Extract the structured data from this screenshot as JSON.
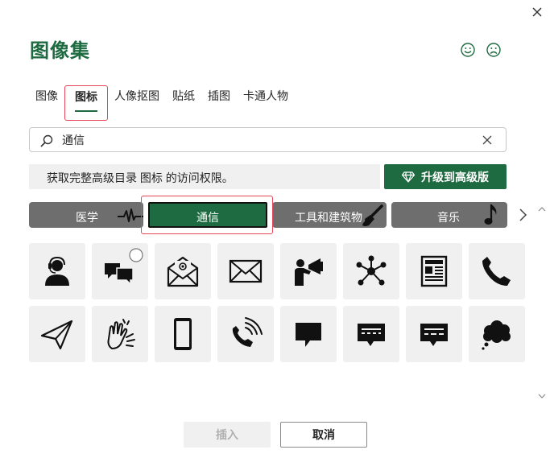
{
  "dialog": {
    "title": "图像集",
    "close_icon": "close-icon",
    "feedback": {
      "happy_icon": "smiley-icon",
      "sad_icon": "frown-icon"
    }
  },
  "tabs": [
    {
      "label": "图像",
      "active": false
    },
    {
      "label": "图标",
      "active": true
    },
    {
      "label": "人像抠图",
      "active": false
    },
    {
      "label": "贴纸",
      "active": false
    },
    {
      "label": "插图",
      "active": false
    },
    {
      "label": "卡通人物",
      "active": false
    }
  ],
  "search": {
    "value": "通信",
    "search_icon": "search-icon",
    "clear_icon": "clear-icon"
  },
  "notice": {
    "text": "获取完整高级目录 图标 的访问权限。"
  },
  "upgrade": {
    "label": "升级到高级版",
    "icon": "diamond-icon"
  },
  "categories": [
    {
      "label": "医学",
      "icon": "heartbeat-icon"
    },
    {
      "label": "通信",
      "selected": true
    },
    {
      "label": "工具和建筑物",
      "icon": "paintbrush-icon"
    },
    {
      "label": "音乐",
      "icon": "music-note-icon"
    }
  ],
  "icons": [
    "headset-agent-icon",
    "chat-bubbles-icon",
    "email-envelope-icon",
    "envelope-icon",
    "megaphone-person-icon",
    "network-hub-icon",
    "newspaper-icon",
    "phone-handset-icon",
    "paper-plane-icon",
    "sign-language-icon",
    "smartphone-icon",
    "phone-ringing-icon",
    "speech-bubble-icon",
    "message-bubble-icon",
    "message-bubble-text-icon",
    "thought-cloud-icon"
  ],
  "buttons": {
    "insert": "插入",
    "cancel": "取消"
  },
  "colors": {
    "accent": "#1e6b41",
    "category_bg": "#6e6e6e",
    "highlight": "#e8465a",
    "tile_bg": "#f0f0f0"
  }
}
